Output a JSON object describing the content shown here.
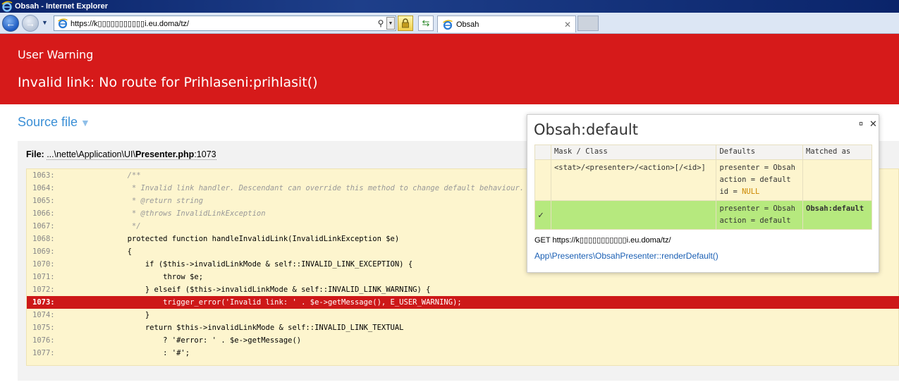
{
  "window": {
    "title": "Obsah - Internet Explorer"
  },
  "browser": {
    "address": "https://k▯▯▯▯▯▯▯▯▯▯▯i.eu.doma/tz/",
    "tab_label": "Obsah",
    "tab_close": "✕",
    "back": "←",
    "forward": "→"
  },
  "error": {
    "type": "User Warning",
    "message": "Invalid link: No route for Prihlaseni:prihlasit()"
  },
  "source": {
    "toggle_label": "Source file",
    "toggle_arrow": "▼",
    "file_label": "File:",
    "file_path_prefix": "...\\nette\\Application\\UI\\",
    "file_name": "Presenter.php",
    "file_line": ":1073"
  },
  "code": {
    "highlight_line": 1073,
    "lines": [
      {
        "num": "1063:",
        "text": "        /**"
      },
      {
        "num": "1064:",
        "text": "         * Invalid link handler. Descendant can override this method to change default behaviour."
      },
      {
        "num": "1065:",
        "text": "         * @return string"
      },
      {
        "num": "1066:",
        "text": "         * @throws InvalidLinkException"
      },
      {
        "num": "1067:",
        "text": "         */"
      },
      {
        "num": "1068:",
        "text": "        protected function handleInvalidLink(InvalidLinkException $e)"
      },
      {
        "num": "1069:",
        "text": "        {"
      },
      {
        "num": "1070:",
        "text": "            if ($this->invalidLinkMode & self::INVALID_LINK_EXCEPTION) {"
      },
      {
        "num": "1071:",
        "text": "                throw $e;"
      },
      {
        "num": "1072:",
        "text": "            } elseif ($this->invalidLinkMode & self::INVALID_LINK_WARNING) {"
      },
      {
        "num": "1073:",
        "text": "                trigger_error('Invalid link: ' . $e->getMessage(), E_USER_WARNING);"
      },
      {
        "num": "1074:",
        "text": "            }"
      },
      {
        "num": "1075:",
        "text": "            return $this->invalidLinkMode & self::INVALID_LINK_TEXTUAL"
      },
      {
        "num": "1076:",
        "text": "                ? '#error: ' . $e->getMessage()"
      },
      {
        "num": "1077:",
        "text": "                : '#';"
      }
    ]
  },
  "routing": {
    "title": "Obsah:default",
    "pin": "¤",
    "close": "✕",
    "headers": {
      "mask": "Mask / Class",
      "defaults": "Defaults",
      "matched": "Matched as"
    },
    "route1": {
      "mask": "<stat>/<presenter>/<action>[/<id>]",
      "default_presenter": "presenter = Obsah",
      "default_action": "action = default",
      "default_id": "id = ",
      "default_id_null": "NULL",
      "matched": ""
    },
    "route2": {
      "check": "✓",
      "mask": "",
      "default_presenter": "presenter = Obsah",
      "default_action": "action = default",
      "matched": "Obsah:default"
    },
    "request": "GET https://k▯▯▯▯▯▯▯▯▯▯▯i.eu.doma/tz/",
    "presenter_link": "App\\Presenters\\ObsahPresenter::renderDefault()"
  }
}
